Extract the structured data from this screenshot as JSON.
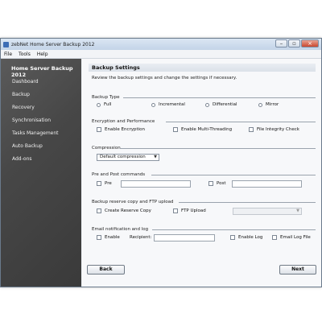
{
  "window": {
    "title": "zebNet Home Server Backup 2012"
  },
  "menu": [
    "File",
    "Tools",
    "Help"
  ],
  "sidebar": {
    "title": "Home Server Backup 2012",
    "items": [
      "Dashboard",
      "Backup",
      "Recovery",
      "Synchronisation",
      "Tasks Management",
      "Auto Backup",
      "Add-ons"
    ]
  },
  "content": {
    "section_title": "Backup Settings",
    "description": "Review the backup settings and change the settings if necessary.",
    "backup_type": {
      "label": "Backup Type",
      "options": [
        "Full",
        "Incremental",
        "Differential",
        "Mirror"
      ]
    },
    "encryption": {
      "label": "Encryption and Performance",
      "options": [
        "Enable Encryption",
        "Enable Multi-Threading",
        "File Integrity Check"
      ]
    },
    "compression": {
      "label": "Compression",
      "value": "Default compression"
    },
    "prepost": {
      "label": "Pre and Post commands",
      "pre": "Pre",
      "post": "Post"
    },
    "reserve": {
      "label": "Backup reserve copy and FTP upload",
      "create_copy": "Create Reserve Copy",
      "ftp": "FTP Upload"
    },
    "email": {
      "label": "Email notification and log",
      "enable": "Enable",
      "recipient": "Recipient:",
      "enable_log": "Enable Log",
      "email_log": "Email Log File"
    },
    "back_label": "Back",
    "next_label": "Next"
  }
}
